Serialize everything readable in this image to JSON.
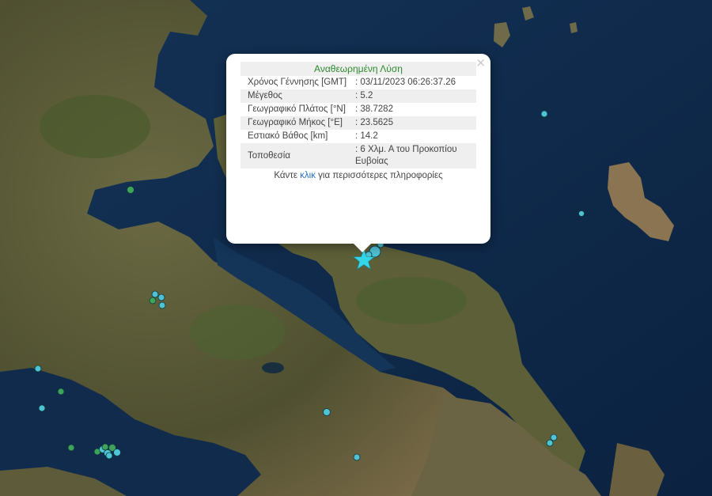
{
  "popup": {
    "title": "Αναθεωρημένη Λύση",
    "close_symbol": "×",
    "rows": [
      {
        "label": "Χρόνος Γέννησης [GMT]",
        "value": ": 03/11/2023 06:26:37.26"
      },
      {
        "label": "Μέγεθος",
        "value": ": 5.2"
      },
      {
        "label": "Γεωγραφικό Πλάτος [°N]",
        "value": ": 38.7282"
      },
      {
        "label": "Γεωγραφικό Μήκος [°E]",
        "value": ": 23.5625"
      },
      {
        "label": "Εστιακό Βάθος [km]",
        "value": ": 14.2"
      },
      {
        "label": "Τοποθεσία",
        "value": ": 6 Χλμ. Α του Προκοπίου Ευβοίας"
      }
    ],
    "more_prefix": "Κάντε ",
    "more_link": "κλικ",
    "more_suffix": " για περισσότερες πληροφορίες"
  },
  "map": {
    "colors": {
      "sea": "#0f2a4a",
      "land": "#5a5a36",
      "marker_cyan": "#4fc3d4",
      "marker_green": "#3da45a",
      "epicenter": "#33d6e8"
    },
    "icons": [
      "star-icon",
      "close-icon"
    ]
  }
}
